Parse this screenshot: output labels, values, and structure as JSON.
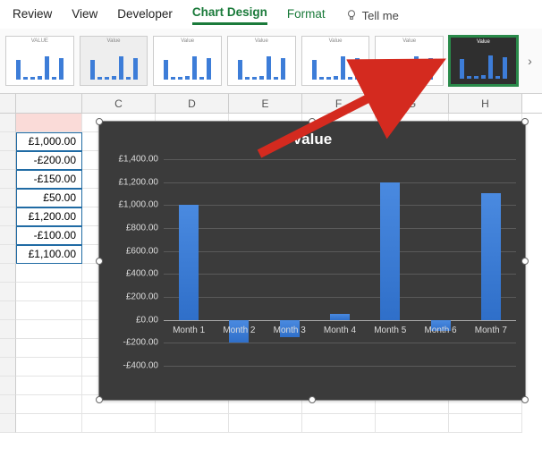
{
  "ribbon": {
    "tabs": [
      "Review",
      "View",
      "Developer",
      "Chart Design",
      "Format"
    ],
    "active": "Chart Design",
    "tellme": "Tell me"
  },
  "gallery": {
    "selected_index": 6,
    "more_glyph": "›"
  },
  "columns": [
    "",
    "",
    "C",
    "D",
    "E",
    "F",
    "G",
    "H"
  ],
  "cells": {
    "b_values": [
      "£1,000.00",
      "-£200.00",
      "-£150.00",
      "£50.00",
      "£1,200.00",
      "-£100.00",
      "£1,100.00"
    ]
  },
  "chart_data": {
    "type": "bar",
    "title": "Value",
    "categories": [
      "Month 1",
      "Month 2",
      "Month 3",
      "Month 4",
      "Month 5",
      "Month 6",
      "Month 7"
    ],
    "values": [
      1000,
      -200,
      -150,
      50,
      1200,
      -100,
      1100
    ],
    "xlabel": "",
    "ylabel": "",
    "ylim": [
      -400,
      1400
    ],
    "yticks": [
      "-£400.00",
      "-£200.00",
      "£0.00",
      "£200.00",
      "£400.00",
      "£600.00",
      "£800.00",
      "£1,000.00",
      "£1,200.00",
      "£1,400.00"
    ]
  }
}
